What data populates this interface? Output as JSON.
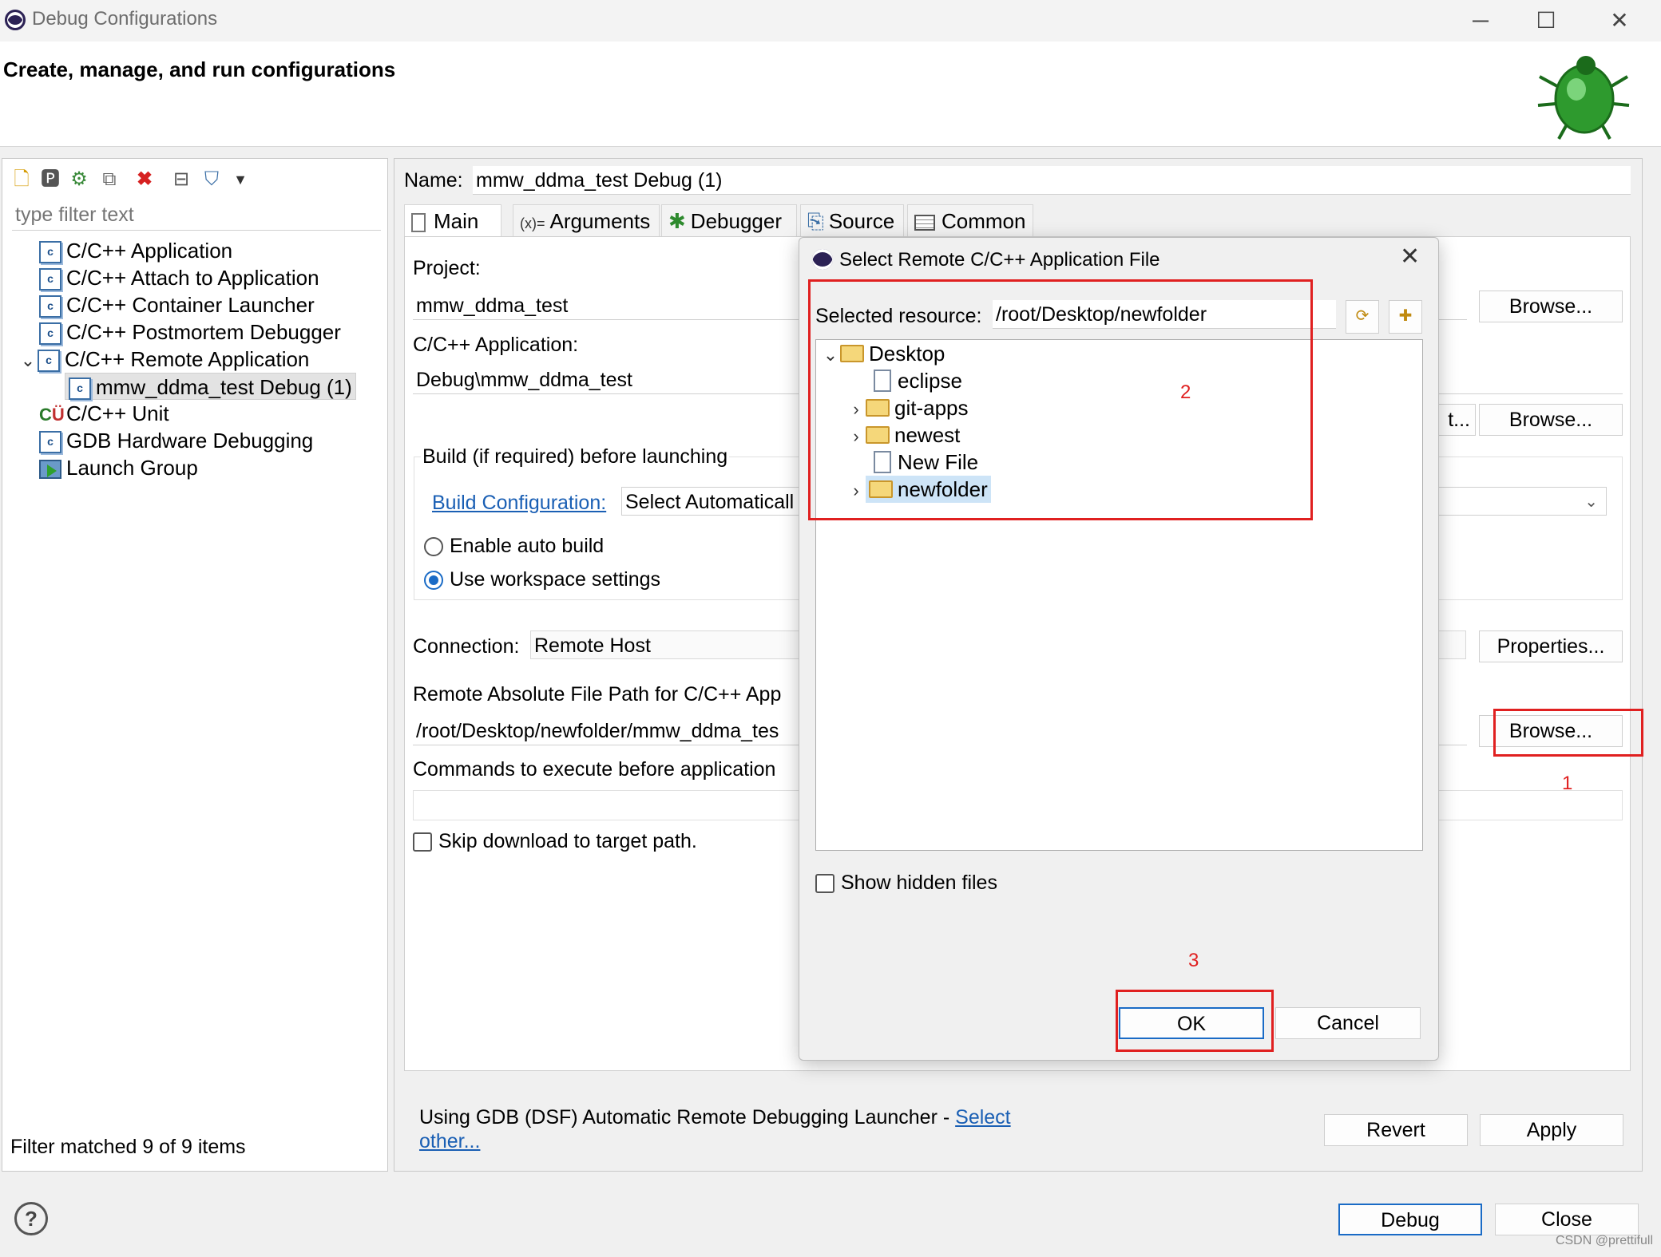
{
  "window": {
    "title": "Debug Configurations",
    "header": "Create, manage, and run configurations"
  },
  "sidebar": {
    "filter_placeholder": "type filter text",
    "items": [
      {
        "label": "C/C++ Application"
      },
      {
        "label": "C/C++ Attach to Application"
      },
      {
        "label": "C/C++ Container Launcher"
      },
      {
        "label": "C/C++ Postmortem Debugger"
      },
      {
        "label": "C/C++ Remote Application"
      },
      {
        "label": "mmw_ddma_test Debug (1)"
      },
      {
        "label": "C/C++ Unit"
      },
      {
        "label": "GDB Hardware Debugging"
      },
      {
        "label": "Launch Group"
      }
    ],
    "status": "Filter matched 9 of 9 items"
  },
  "config": {
    "name_label": "Name:",
    "name_value": "mmw_ddma_test Debug (1)",
    "tabs": [
      "Main",
      "Arguments",
      "Debugger",
      "Source",
      "Common"
    ],
    "project_label": "Project:",
    "project_value": "mmw_ddma_test",
    "app_label": "C/C++ Application:",
    "app_value": "Debug\\mmw_ddma_test",
    "build_group_label": "Build (if required) before launching",
    "build_config_link": "Build Configuration:",
    "build_config_value": "Select Automaticall",
    "radio_auto": "Enable auto build",
    "radio_workspace": "Use workspace settings",
    "connection_label": "Connection:",
    "connection_value": "Remote Host",
    "remote_path_label": "Remote Absolute File Path for C/C++ App",
    "remote_path_value": "/root/Desktop/newfolder/mmw_ddma_tes",
    "commands_label": "Commands to execute before application",
    "skip_download": "Skip download to target path.",
    "browse": "Browse...",
    "partial_button": "t...",
    "properties": "Properties...",
    "launcher_text": "Using GDB (DSF) Automatic Remote Debugging Launcher - ",
    "launcher_link1": "Select",
    "launcher_link2": "other...",
    "revert": "Revert",
    "apply": "Apply"
  },
  "footer": {
    "debug": "Debug",
    "close": "Close",
    "watermark": "CSDN @prettifull"
  },
  "dialog": {
    "title": "Select Remote C/C++ Application File",
    "selected_label": "Selected resource:",
    "selected_value": "/root/Desktop/newfolder",
    "tree": [
      {
        "label": "Desktop"
      },
      {
        "label": "eclipse"
      },
      {
        "label": "git-apps"
      },
      {
        "label": "newest"
      },
      {
        "label": "New File"
      },
      {
        "label": "newfolder"
      }
    ],
    "show_hidden": "Show hidden files",
    "ok": "OK",
    "cancel": "Cancel"
  },
  "annotations": {
    "n1": "1",
    "n2": "2",
    "n3": "3"
  },
  "colors": {
    "accent": "#1a6bc6",
    "annotation": "#e02020",
    "link": "#1a5fb4"
  }
}
